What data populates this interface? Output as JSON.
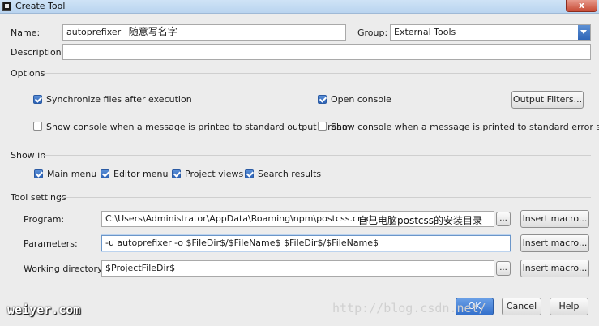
{
  "window": {
    "title": "Create Tool",
    "close_label": "x"
  },
  "name": {
    "label": "Name:",
    "value": "autoprefixer",
    "annotation": "随意写名字"
  },
  "group": {
    "label": "Group:",
    "value": "External Tools"
  },
  "description": {
    "label": "Description:",
    "value": ""
  },
  "options": {
    "title": "Options",
    "sync_files": "Synchronize files after execution",
    "open_console": "Open console",
    "output_filters": "Output Filters...",
    "show_console_stdout": "Show console when a message is printed to standard output stream",
    "show_console_stderr": "Show console when a message is printed to standard error stream"
  },
  "show_in": {
    "title": "Show in",
    "main_menu": "Main menu",
    "editor_menu": "Editor menu",
    "project_views": "Project views",
    "search_results": "Search results"
  },
  "tool_settings": {
    "title": "Tool settings",
    "program_label": "Program:",
    "program_value": "C:\\Users\\Administrator\\AppData\\Roaming\\npm\\postcss.cmd",
    "program_annotation": "自己电脑postcss的安装目录",
    "parameters_label": "Parameters:",
    "parameters_value": "-u autoprefixer -o $FileDir$/$FileName$  $FileDir$/$FileName$",
    "workdir_label": "Working directory:",
    "workdir_value": "$ProjectFileDir$",
    "browse_label": "...",
    "insert_macro": "Insert macro..."
  },
  "footer": {
    "ok": "OK",
    "cancel": "Cancel",
    "help": "Help"
  },
  "watermarks": {
    "left": "weiyer.com",
    "right": "http://blog.csdn.net/"
  }
}
